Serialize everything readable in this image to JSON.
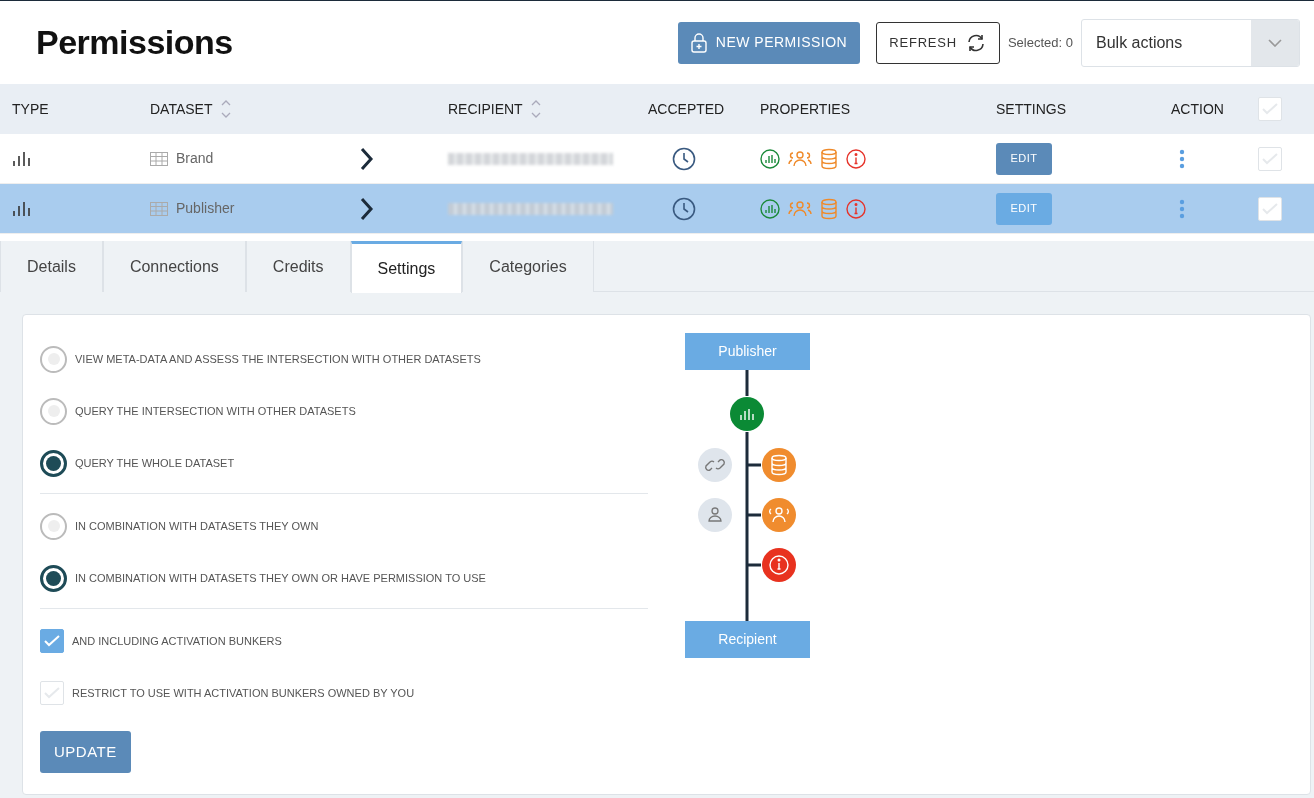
{
  "header": {
    "title": "Permissions",
    "new_button": "NEW PERMISSION",
    "refresh_button": "REFRESH",
    "selected_label": "Selected: 0",
    "bulk_select": {
      "value": "Bulk actions"
    }
  },
  "table": {
    "columns": [
      {
        "label": "TYPE",
        "sortable": false
      },
      {
        "label": "DATASET",
        "sortable": true
      },
      {
        "label": "RECIPIENT",
        "sortable": true
      },
      {
        "label": "ACCEPTED",
        "sortable": false
      },
      {
        "label": "PROPERTIES",
        "sortable": false
      },
      {
        "label": "SETTINGS",
        "sortable": false
      },
      {
        "label": "ACTION",
        "sortable": false
      }
    ],
    "header_checked": false,
    "rows": [
      {
        "dataset": "Brand",
        "settings_button": "EDIT",
        "selected": false,
        "checked": false
      },
      {
        "dataset": "Publisher",
        "settings_button": "EDIT",
        "selected": true,
        "checked": false
      }
    ]
  },
  "tabs": [
    {
      "label": "Details",
      "selected": false
    },
    {
      "label": "Connections",
      "selected": false
    },
    {
      "label": "Credits",
      "selected": false
    },
    {
      "label": "Settings",
      "selected": true
    },
    {
      "label": "Categories",
      "selected": false
    }
  ],
  "settings": {
    "groups": [
      [
        {
          "kind": "radio",
          "label": "VIEW META-DATA AND ASSESS THE INTERSECTION WITH OTHER DATASETS",
          "checked": false
        },
        {
          "kind": "radio",
          "label": "QUERY THE INTERSECTION WITH OTHER DATASETS",
          "checked": false
        },
        {
          "kind": "radio",
          "label": "QUERY THE WHOLE DATASET",
          "checked": true
        }
      ],
      [
        {
          "kind": "radio",
          "label": "IN COMBINATION WITH DATASETS THEY OWN",
          "checked": false
        },
        {
          "kind": "radio",
          "label": "IN COMBINATION WITH DATASETS THEY OWN OR HAVE PERMISSION TO USE",
          "checked": true
        }
      ],
      [
        {
          "kind": "checkbox",
          "label": "AND INCLUDING ACTIVATION BUNKERS",
          "checked": true
        },
        {
          "kind": "checkbox",
          "label": "RESTRICT TO USE WITH ACTIVATION BUNKERS OWNED BY YOU",
          "checked": false
        }
      ]
    ],
    "update_button": "UPDATE",
    "diagram": {
      "top": "Publisher",
      "bottom": "Recipient"
    }
  }
}
